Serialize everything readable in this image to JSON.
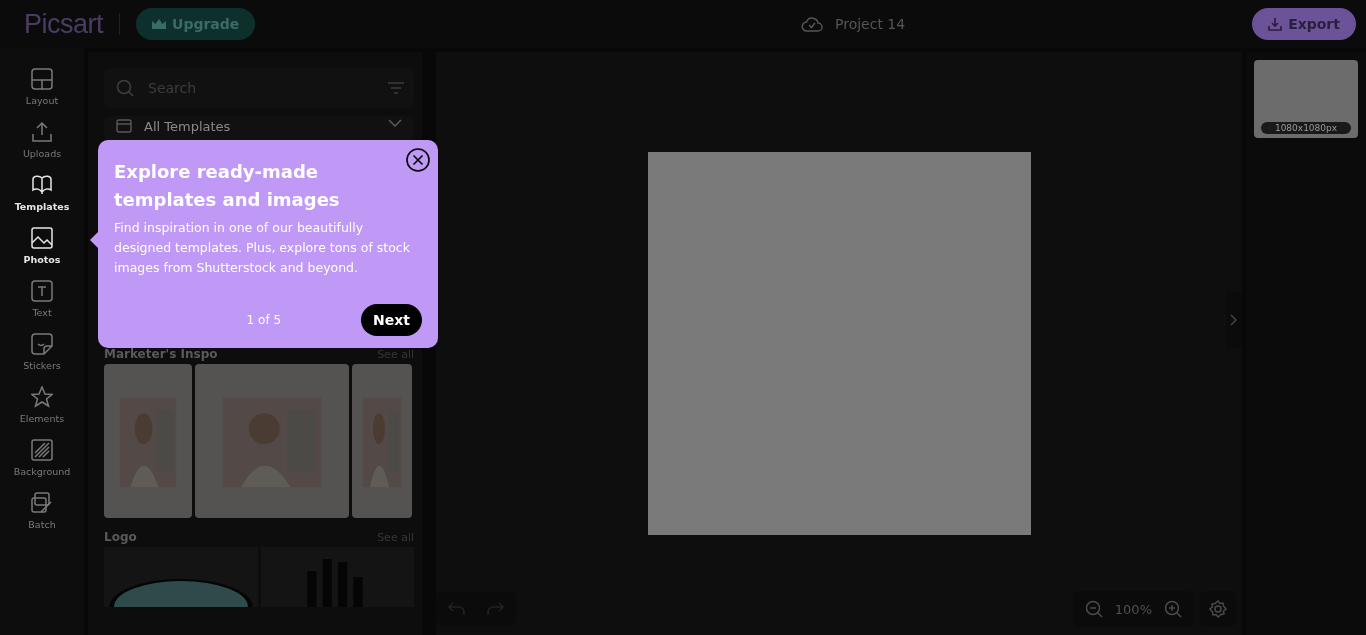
{
  "header": {
    "logo": "Picsart",
    "upgrade": "Upgrade",
    "project": "Project 14",
    "export": "Export"
  },
  "sidebar": {
    "items": [
      {
        "label": "Layout",
        "highlighted": false
      },
      {
        "label": "Uploads",
        "highlighted": false
      },
      {
        "label": "Templates",
        "highlighted": true
      },
      {
        "label": "Photos",
        "highlighted": true
      },
      {
        "label": "Text",
        "highlighted": false
      },
      {
        "label": "Stickers",
        "highlighted": false
      },
      {
        "label": "Elements",
        "highlighted": false
      },
      {
        "label": "Background",
        "highlighted": false
      },
      {
        "label": "Batch",
        "highlighted": false
      }
    ]
  },
  "panel": {
    "search": {
      "placeholder": "Search"
    },
    "category": "All Templates",
    "sections": [
      {
        "title": "Marketer's Inspo",
        "see_all": "See all"
      },
      {
        "title": "Logo",
        "see_all": "See all"
      }
    ]
  },
  "tooltip": {
    "title": "Explore ready-made templates and images",
    "body": "Find inspiration in one of our beautifully designed templates. Plus, explore tons of stock images from Shutterstock and beyond.",
    "step": "1 of 5",
    "next": "Next"
  },
  "canvas": {
    "zoom": "100%"
  },
  "pages": [
    {
      "size": "1080x1080px"
    }
  ]
}
